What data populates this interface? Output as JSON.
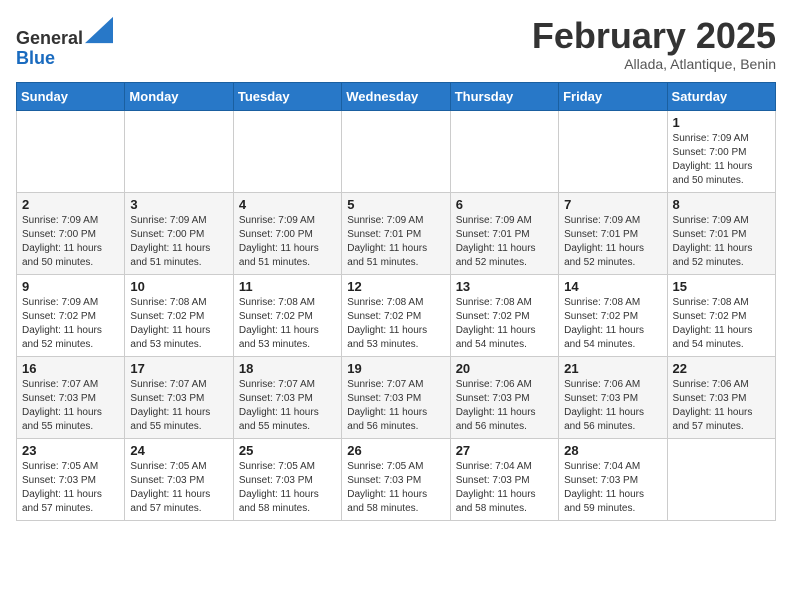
{
  "header": {
    "logo_line1": "General",
    "logo_line2": "Blue",
    "month": "February 2025",
    "location": "Allada, Atlantique, Benin"
  },
  "days_of_week": [
    "Sunday",
    "Monday",
    "Tuesday",
    "Wednesday",
    "Thursday",
    "Friday",
    "Saturday"
  ],
  "weeks": [
    [
      {
        "day": "",
        "info": ""
      },
      {
        "day": "",
        "info": ""
      },
      {
        "day": "",
        "info": ""
      },
      {
        "day": "",
        "info": ""
      },
      {
        "day": "",
        "info": ""
      },
      {
        "day": "",
        "info": ""
      },
      {
        "day": "1",
        "info": "Sunrise: 7:09 AM\nSunset: 7:00 PM\nDaylight: 11 hours\nand 50 minutes."
      }
    ],
    [
      {
        "day": "2",
        "info": "Sunrise: 7:09 AM\nSunset: 7:00 PM\nDaylight: 11 hours\nand 50 minutes."
      },
      {
        "day": "3",
        "info": "Sunrise: 7:09 AM\nSunset: 7:00 PM\nDaylight: 11 hours\nand 51 minutes."
      },
      {
        "day": "4",
        "info": "Sunrise: 7:09 AM\nSunset: 7:00 PM\nDaylight: 11 hours\nand 51 minutes."
      },
      {
        "day": "5",
        "info": "Sunrise: 7:09 AM\nSunset: 7:01 PM\nDaylight: 11 hours\nand 51 minutes."
      },
      {
        "day": "6",
        "info": "Sunrise: 7:09 AM\nSunset: 7:01 PM\nDaylight: 11 hours\nand 52 minutes."
      },
      {
        "day": "7",
        "info": "Sunrise: 7:09 AM\nSunset: 7:01 PM\nDaylight: 11 hours\nand 52 minutes."
      },
      {
        "day": "8",
        "info": "Sunrise: 7:09 AM\nSunset: 7:01 PM\nDaylight: 11 hours\nand 52 minutes."
      }
    ],
    [
      {
        "day": "9",
        "info": "Sunrise: 7:09 AM\nSunset: 7:02 PM\nDaylight: 11 hours\nand 52 minutes."
      },
      {
        "day": "10",
        "info": "Sunrise: 7:08 AM\nSunset: 7:02 PM\nDaylight: 11 hours\nand 53 minutes."
      },
      {
        "day": "11",
        "info": "Sunrise: 7:08 AM\nSunset: 7:02 PM\nDaylight: 11 hours\nand 53 minutes."
      },
      {
        "day": "12",
        "info": "Sunrise: 7:08 AM\nSunset: 7:02 PM\nDaylight: 11 hours\nand 53 minutes."
      },
      {
        "day": "13",
        "info": "Sunrise: 7:08 AM\nSunset: 7:02 PM\nDaylight: 11 hours\nand 54 minutes."
      },
      {
        "day": "14",
        "info": "Sunrise: 7:08 AM\nSunset: 7:02 PM\nDaylight: 11 hours\nand 54 minutes."
      },
      {
        "day": "15",
        "info": "Sunrise: 7:08 AM\nSunset: 7:02 PM\nDaylight: 11 hours\nand 54 minutes."
      }
    ],
    [
      {
        "day": "16",
        "info": "Sunrise: 7:07 AM\nSunset: 7:03 PM\nDaylight: 11 hours\nand 55 minutes."
      },
      {
        "day": "17",
        "info": "Sunrise: 7:07 AM\nSunset: 7:03 PM\nDaylight: 11 hours\nand 55 minutes."
      },
      {
        "day": "18",
        "info": "Sunrise: 7:07 AM\nSunset: 7:03 PM\nDaylight: 11 hours\nand 55 minutes."
      },
      {
        "day": "19",
        "info": "Sunrise: 7:07 AM\nSunset: 7:03 PM\nDaylight: 11 hours\nand 56 minutes."
      },
      {
        "day": "20",
        "info": "Sunrise: 7:06 AM\nSunset: 7:03 PM\nDaylight: 11 hours\nand 56 minutes."
      },
      {
        "day": "21",
        "info": "Sunrise: 7:06 AM\nSunset: 7:03 PM\nDaylight: 11 hours\nand 56 minutes."
      },
      {
        "day": "22",
        "info": "Sunrise: 7:06 AM\nSunset: 7:03 PM\nDaylight: 11 hours\nand 57 minutes."
      }
    ],
    [
      {
        "day": "23",
        "info": "Sunrise: 7:05 AM\nSunset: 7:03 PM\nDaylight: 11 hours\nand 57 minutes."
      },
      {
        "day": "24",
        "info": "Sunrise: 7:05 AM\nSunset: 7:03 PM\nDaylight: 11 hours\nand 57 minutes."
      },
      {
        "day": "25",
        "info": "Sunrise: 7:05 AM\nSunset: 7:03 PM\nDaylight: 11 hours\nand 58 minutes."
      },
      {
        "day": "26",
        "info": "Sunrise: 7:05 AM\nSunset: 7:03 PM\nDaylight: 11 hours\nand 58 minutes."
      },
      {
        "day": "27",
        "info": "Sunrise: 7:04 AM\nSunset: 7:03 PM\nDaylight: 11 hours\nand 58 minutes."
      },
      {
        "day": "28",
        "info": "Sunrise: 7:04 AM\nSunset: 7:03 PM\nDaylight: 11 hours\nand 59 minutes."
      },
      {
        "day": "",
        "info": ""
      }
    ]
  ]
}
